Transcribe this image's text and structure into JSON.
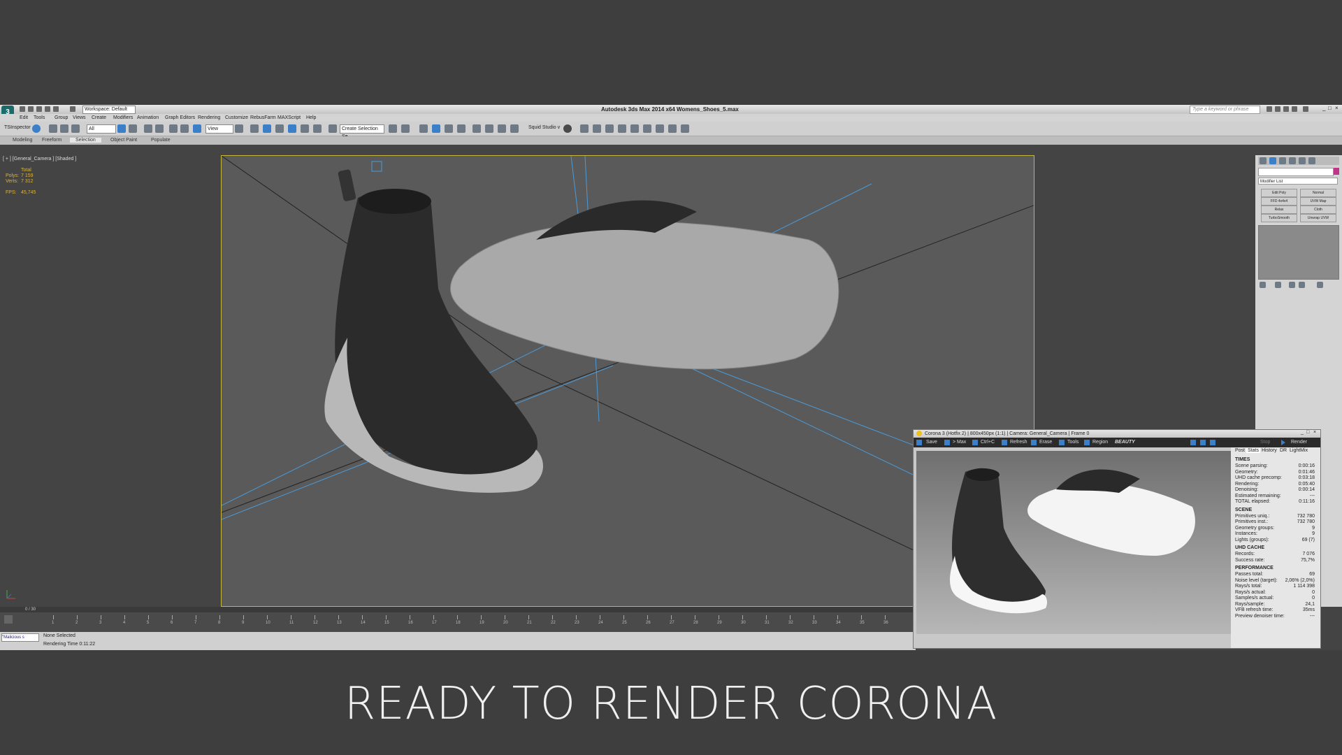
{
  "app": {
    "title": "Autodesk 3ds Max  2014 x64    Womens_Shoes_5.max",
    "workspace": "Workspace: Default",
    "search_placeholder": "Type a keyword or phrase"
  },
  "menu": [
    "Edit",
    "Tools",
    "Group",
    "Views",
    "Create",
    "Modifiers",
    "Animation",
    "Graph Editors",
    "Rendering",
    "Customize",
    "RebusFarm",
    "MAXScript",
    "Help"
  ],
  "toolbar": {
    "inspector_label": "TSInspector",
    "filter_value": "All",
    "view_value": "View",
    "selection_set": "Create Selection Se",
    "squid_label": "Squid Studio v"
  },
  "ribbon_tabs": [
    "Modeling",
    "Freeform",
    "Selection",
    "Object Paint",
    "Populate"
  ],
  "ribbon_active": "Selection",
  "viewport": {
    "label": "[ + ] [General_Camera ] [Shaded ]",
    "stats": {
      "total": "Total",
      "polys_label": "Polys:",
      "polys": "7 159",
      "verts_label": "Verts:",
      "verts": "7 312",
      "fps_label": "FPS:",
      "fps": "45,745"
    }
  },
  "command_panel": {
    "modifier_list": "Modifier List",
    "buttons": [
      "Edit Poly",
      "Normal",
      "FFD 4x4x4",
      "UVW Map",
      "Relax",
      "Cloth",
      "TurboSmooth",
      "Unwrap UVW"
    ]
  },
  "timeline": {
    "frame_readout": "0 / 30",
    "ticks": [
      "1",
      "2",
      "3",
      "4",
      "5",
      "6",
      "7",
      "8",
      "9",
      "10",
      "11",
      "12",
      "13",
      "14",
      "15",
      "16",
      "17",
      "18",
      "19",
      "20",
      "21",
      "22",
      "23",
      "24",
      "25",
      "26",
      "27",
      "28",
      "29",
      "30",
      "31",
      "32",
      "33",
      "34",
      "35",
      "36"
    ]
  },
  "status": {
    "selection": "None Selected",
    "render_time": "Rendering Time  0:11:22",
    "script_box": "\"Malicious s"
  },
  "vfb": {
    "title": "Corona 3 (Hotfix 2) | 800x450px (1:1) | Camera: General_Camera | Frame 0",
    "buttons": [
      "Save",
      "> Max",
      "Ctrl+C",
      "Refresh",
      "Erase",
      "Tools",
      "Region"
    ],
    "channel": "BEAUTY",
    "stop_label": "Stop",
    "render_label": "Render",
    "tabs": [
      "Post",
      "Stats",
      "History",
      "DR",
      "LightMix"
    ],
    "active_tab": "Stats",
    "sections": [
      {
        "name": "TIMES",
        "rows": [
          [
            "Scene parsing:",
            "0:00:16"
          ],
          [
            "Geometry:",
            "0:01:46"
          ],
          [
            "UHD cache precomp:",
            "0:03:18"
          ],
          [
            "Rendering:",
            "0:05:40"
          ],
          [
            "Denoising:",
            "0:00:14"
          ],
          [
            "Estimated remaining:",
            "---"
          ],
          [
            "TOTAL elapsed:",
            "0:11:16"
          ]
        ]
      },
      {
        "name": "SCENE",
        "rows": [
          [
            "Primitives uniq.:",
            "732 780"
          ],
          [
            "Primitives inst.:",
            "732 780"
          ],
          [
            "Geometry groups:",
            "9"
          ],
          [
            "Instances:",
            "9"
          ],
          [
            "Lights (groups):",
            "69 (7)"
          ]
        ]
      },
      {
        "name": "UHD CACHE",
        "rows": [
          [
            "Records:",
            "7 076"
          ],
          [
            "Success rate:",
            "75,7%"
          ]
        ]
      },
      {
        "name": "PERFORMANCE",
        "rows": [
          [
            "Passes total:",
            "69"
          ],
          [
            "Noise level (target):",
            "2,06% (2,0%)"
          ],
          [
            "Rays/s total:",
            "1 114 398"
          ],
          [
            "Rays/s actual:",
            "0"
          ],
          [
            "Samples/s actual:",
            "0"
          ],
          [
            "Rays/sample:",
            "24,1"
          ],
          [
            "VFB refresh time:",
            "35ms"
          ],
          [
            "Preview denoiser time:",
            "---"
          ]
        ]
      }
    ]
  },
  "caption": "READY TO RENDER  CORONA",
  "colors": {
    "viewport_border": "#c4b840",
    "stat_text": "#d7b44a",
    "accent_blue": "#3a7fc7"
  }
}
